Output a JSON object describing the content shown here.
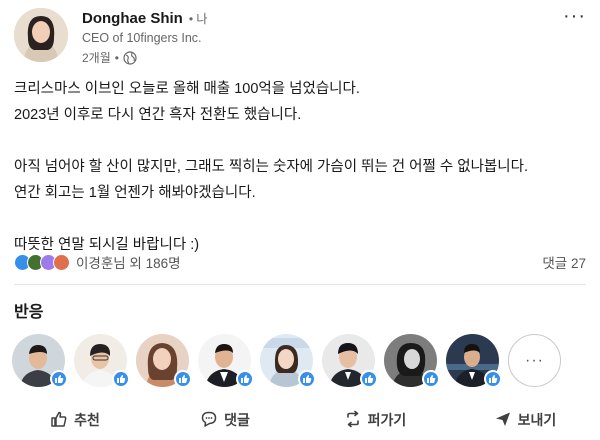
{
  "post": {
    "author": {
      "name": "Donghae Shin",
      "degree": "• 나",
      "headline": "CEO of 10fingers Inc.",
      "time": "2개월",
      "dot": "•",
      "visibility_icon": "globe-icon"
    },
    "more_menu": "···",
    "body": [
      "크리스마스 이브인 오늘로 올해 매출 100억을 넘었습니다.",
      "2023년 이후로 다시 연간 흑자 전환도 했습니다.",
      "",
      "아직 넘어야 할 산이 많지만, 그래도 찍히는 숫자에 가슴이 뛰는 건 어쩔 수 없나봅니다.",
      "연간 회고는 1월 언젠가 해봐야겠습니다.",
      "",
      "따뜻한 연말 되시길 바랍니다 :)"
    ],
    "reactions_summary": "이경훈님 외 186명",
    "comments_count": "댓글 27",
    "reaction_icons": [
      "like-icon",
      "celebrate-icon",
      "support-icon",
      "love-icon"
    ]
  },
  "reactions_section": {
    "title": "반응",
    "more_label": "···"
  },
  "actions": {
    "like": "추천",
    "comment": "댓글",
    "repost": "퍼가기",
    "send": "보내기"
  },
  "colors": {
    "accent": "#378fe9",
    "text": "#191919",
    "muted": "#666666"
  }
}
